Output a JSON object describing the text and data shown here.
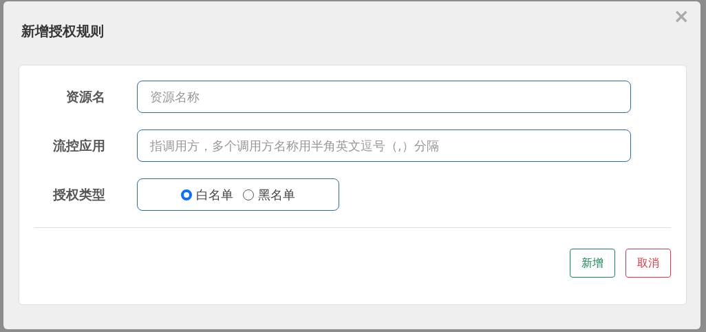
{
  "dialog": {
    "title": "新增授权规则",
    "close": "×"
  },
  "fields": [
    {
      "kind": "text",
      "label": "资源名",
      "placeholder": "资源名称"
    },
    {
      "kind": "text",
      "label": "流控应用",
      "placeholder": "指调用方，多个调用方名称用半角英文逗号（,）分隔"
    },
    {
      "kind": "radio",
      "label": "授权类型",
      "options": [
        {
          "label": "白名单",
          "selected": true
        },
        {
          "label": "黑名单",
          "selected": false
        }
      ]
    }
  ],
  "buttons": [
    {
      "kind": "confirm",
      "label": "新增"
    },
    {
      "kind": "cancel",
      "label": "取消"
    }
  ]
}
